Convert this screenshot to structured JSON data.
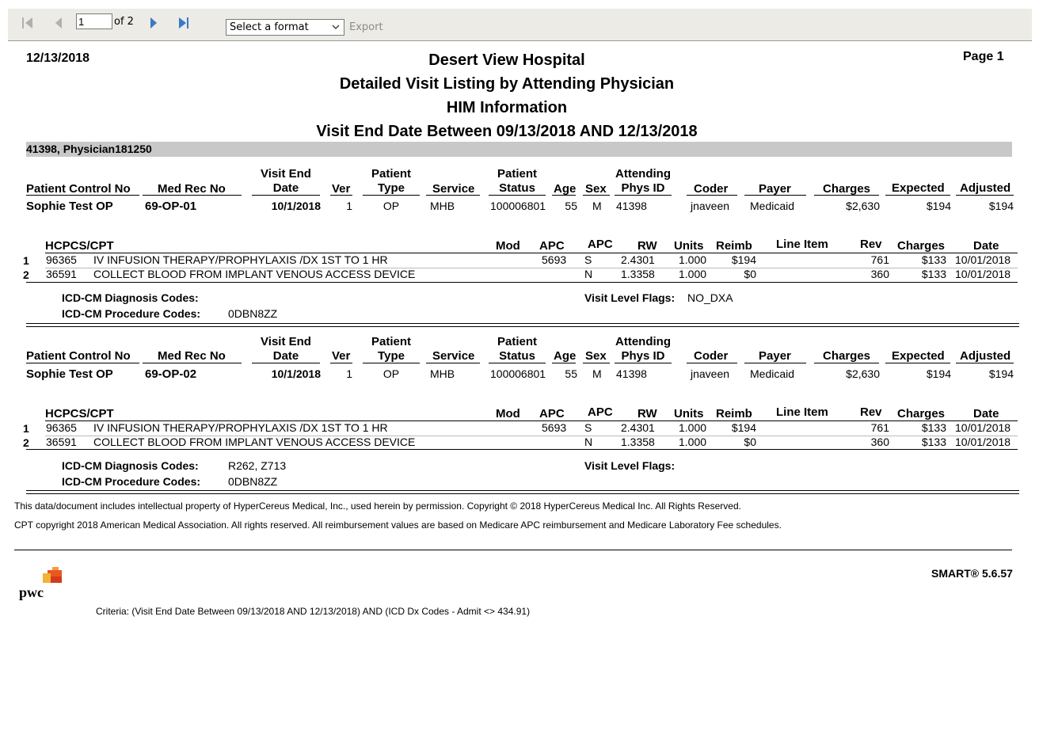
{
  "toolbar": {
    "first_icon": "first-page-icon",
    "prev_icon": "previous-page-icon",
    "page_value": "1",
    "of_text": "of 2",
    "next_icon": "next-page-icon",
    "last_icon": "last-page-icon",
    "format_placeholder": "Select a format",
    "export_label": "Export",
    "export_color": "#8a8a8a"
  },
  "report": {
    "date": "12/13/2018",
    "page": "Page 1",
    "title1": "Desert View Hospital",
    "title2": "Detailed Visit Listing by Attending Physician",
    "title3": "HIM Information",
    "title4": "Visit End Date Between 09/13/2018 AND 12/13/2018",
    "group_header": "41398, Physician181250",
    "group_bg": "#c8c8c8"
  },
  "visit_headers": {
    "patient_control_no": "Patient Control No",
    "med_rec_no": "Med Rec No",
    "visit_end_date_1": "Visit End",
    "visit_end_date_2": "Date",
    "ver": "Ver",
    "patient_type_1": "Patient",
    "patient_type_2": "Type",
    "service": "Service",
    "patient_status_1": "Patient",
    "patient_status_2": "Status",
    "age": "Age",
    "sex": "Sex",
    "attending_1": "Attending",
    "attending_2": "Phys ID",
    "coder": "Coder",
    "payer": "Payer",
    "charges": "Charges",
    "expected": "Expected",
    "adjusted": "Adjusted"
  },
  "line_headers": {
    "hcpcs": "HCPCS/CPT",
    "mod": "Mod",
    "apc": "APC",
    "apc2": "APC",
    "rw": "RW",
    "units": "Units",
    "reimb": "Reimb",
    "line_item": "Line Item",
    "rev": "Rev",
    "charges": "Charges",
    "date": "Date"
  },
  "labels": {
    "dx_codes": "ICD-CM Diagnosis Codes:",
    "proc_codes": "ICD-CM Procedure Codes:",
    "visit_flags": "Visit Level Flags:"
  },
  "visits": [
    {
      "patient_control_no": "Sophie Test OP",
      "med_rec_no": "69-OP-01",
      "visit_end_date": "10/1/2018",
      "ver": "1",
      "patient_type": "OP",
      "service": "MHB",
      "patient_status": "100006801",
      "age": "55",
      "sex": "M",
      "attending": "41398",
      "coder": "jnaveen",
      "payer": "Medicaid",
      "charges": "$2,630",
      "expected": "$194",
      "adjusted": "$194",
      "lines": [
        {
          "n": "1",
          "code": "96365",
          "desc": "IV INFUSION THERAPY/PROPHYLAXIS /DX 1ST TO 1 HR",
          "apc": "5693",
          "apc2": "S",
          "rw": "2.4301",
          "units": "1.000",
          "reimb": "$194",
          "rev": "761",
          "charges": "$133",
          "date": "10/01/2018"
        },
        {
          "n": "2",
          "code": "36591",
          "desc": "COLLECT BLOOD FROM IMPLANT VENOUS ACCESS DEVICE",
          "apc": "",
          "apc2": "N",
          "rw": "1.3358",
          "units": "1.000",
          "reimb": "$0",
          "rev": "360",
          "charges": "$133",
          "date": "10/01/2018"
        }
      ],
      "dx_codes": "",
      "proc_codes": "0DBN8ZZ",
      "visit_flags": "NO_DXA"
    },
    {
      "patient_control_no": "Sophie Test OP",
      "med_rec_no": "69-OP-02",
      "visit_end_date": "10/1/2018",
      "ver": "1",
      "patient_type": "OP",
      "service": "MHB",
      "patient_status": "100006801",
      "age": "55",
      "sex": "M",
      "attending": "41398",
      "coder": "jnaveen",
      "payer": "Medicaid",
      "charges": "$2,630",
      "expected": "$194",
      "adjusted": "$194",
      "lines": [
        {
          "n": "1",
          "code": "96365",
          "desc": "IV INFUSION THERAPY/PROPHYLAXIS /DX 1ST TO 1 HR",
          "apc": "5693",
          "apc2": "S",
          "rw": "2.4301",
          "units": "1.000",
          "reimb": "$194",
          "rev": "761",
          "charges": "$133",
          "date": "10/01/2018"
        },
        {
          "n": "2",
          "code": "36591",
          "desc": "COLLECT BLOOD FROM IMPLANT VENOUS ACCESS DEVICE",
          "apc": "",
          "apc2": "N",
          "rw": "1.3358",
          "units": "1.000",
          "reimb": "$0",
          "rev": "360",
          "charges": "$133",
          "date": "10/01/2018"
        }
      ],
      "dx_codes": "R262, Z713",
      "proc_codes": "0DBN8ZZ",
      "visit_flags": ""
    }
  ],
  "footer": {
    "copyright1": "This data/document includes intellectual property of HyperCereus Medical, Inc., used herein by permission. Copyright © 2018 HyperCereus Medical Inc. All Rights Reserved.",
    "copyright2": "CPT copyright 2018 American Medical Association. All rights reserved. All reimbursement values are based on Medicare APC reimbursement and Medicare Laboratory Fee schedules.",
    "version": "SMART® 5.6.57",
    "logo_text": "pwc",
    "criteria": "Criteria: (Visit End Date Between 09/13/2018 AND 12/13/2018) AND (ICD Dx Codes - Admit <> 434.91)"
  }
}
